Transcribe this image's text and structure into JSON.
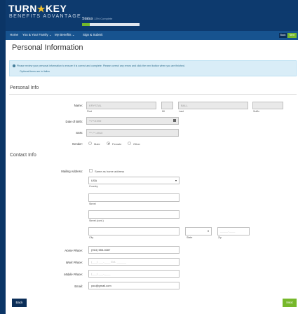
{
  "brand": {
    "name_left": "TURN",
    "star": "★",
    "name_right": "KEY",
    "tagline": "BENEFITS ADVANTAGE"
  },
  "status": {
    "label": "Status",
    "percent_text": "13% Complete",
    "progress": 0.13
  },
  "nav": {
    "items": [
      "Home",
      "You & Your Family ⌄",
      "My Benefits ⌄",
      "Sign & Submit"
    ],
    "back": "Back",
    "next": "Next"
  },
  "page_title": "Personal Information",
  "alert": {
    "message": "Please review your personal information to ensure it is correct and complete. Please correct any errors and click the next button when you are finished.",
    "note": "Optional items are in italics"
  },
  "personal_info": {
    "heading": "Personal Info",
    "name_label": "Name:",
    "first_value": "KRYSTAL",
    "mi_value": "",
    "last_value": "BALL",
    "suffix_value": "",
    "first_caption": "First",
    "mi_caption": "MI",
    "last_caption": "Last",
    "suffix_caption": "Suffix",
    "dob_label": "Date of Birth:",
    "dob_value": "**/**/1999",
    "ssn_label": "SSN:",
    "ssn_value": "***-**-4910",
    "gender_label": "Gender:",
    "gender_options": [
      "Male",
      "Female",
      "Other"
    ],
    "gender_selected": "Female"
  },
  "contact_info": {
    "heading": "Contact Info",
    "mailing_label": "Mailing Address:",
    "same_as_home": "Same as home address",
    "country_value": "USA",
    "country_caption": "Country",
    "street_caption": "Street",
    "street_cont_caption": "Street (cont.)",
    "city_caption": "City",
    "state_caption": "State",
    "zip_caption": "Zip",
    "zip_placeholder": "_____-____",
    "home_phone_label": "Home Phone:",
    "home_phone_value": "(913) 555-0287",
    "work_phone_label": "Work Phone:",
    "work_phone_placeholder": "(___) ___-____ Ext. ______",
    "mobile_phone_label": "Mobile Phone:",
    "mobile_phone_placeholder": "(___) ___-____",
    "email_label": "Email:",
    "email_value": "you@gmail.com"
  },
  "footer": {
    "back": "Back",
    "next": "Next"
  },
  "colors": {
    "header": "#0d3a6e",
    "nav": "#17538f",
    "accent_green": "#76b82b",
    "back_button": "#0b2e58",
    "alert_bg": "#d9edf7"
  }
}
